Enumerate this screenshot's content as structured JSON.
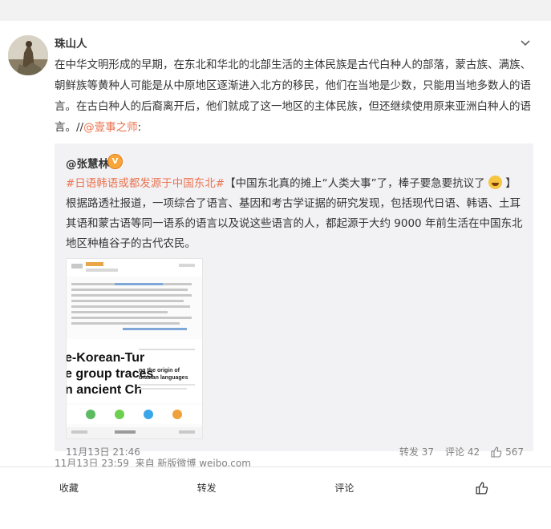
{
  "post": {
    "author": "珠山人",
    "text": "在中华文明形成的早期，在东北和华北的北部生活的主体民族是古代白种人的部落，蒙古族、满族、朝鲜族等黄种人可能是从中原地区逐渐进入北方的移民，他们在当地是少数，只能用当地多数人的语言。在古白种人的后裔离开后，他们就成了这一地区的主体民族，但还继续使用原来亚洲白种人的语言。//",
    "mention": "@壹事之师",
    "mention_suffix": ":",
    "timestamp": "11月13日 23:59",
    "source": "来自 新版微博 weibo.com"
  },
  "repost": {
    "author": "@张慧林",
    "badge": "V",
    "hashtag1": "#日语韩语或都发源于中国东北#",
    "text1": "【中国东北真的摊上“人类大事”了，棒子要急要抗议了",
    "text2": "】根据路透社报道，一项综合了语言、基因和考古学证据的研究发现，包括现代日语、韩语、土耳其语和蒙古语等同一语系的语言以及说这些语言的人，都起源于大约 9000 年前生活在中国东北地区种植谷子的古代农民。",
    "timestamp": "11月13日 21:46",
    "actions": {
      "repost": "转发 37",
      "comment": "评论 42",
      "like": "567"
    },
    "thumb": {
      "line1": "【《自然》发布研究：#日语韩语或都发源于中国东北#】中国东北真的摊上\"人类大事\"了。它虽不像宇宙的尽头，但可能是数亿人说的语言的源头！根据路透社报道，一项综合了语言、基因和考古学证据的研究发现，包括现代日语、韩语、土耳其语和蒙古语等同一语系的语言以及说这些语言的人，都起源于大约9000年前生活在中国东北地区种植谷子的古代农民。⊘《自然》发布研究：日语、韩语或都发源于中国…",
      "big1": "e-Korean-Tur",
      "big2": "e group traces",
      "big3": "n ancient Ch",
      "small1": "ng the origin of",
      "small2": "urasian languages"
    }
  },
  "bottom_bar": {
    "favorite": "收藏",
    "repost": "转发",
    "comment": "评论"
  }
}
